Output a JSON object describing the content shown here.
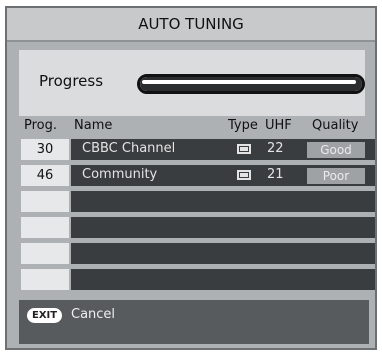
{
  "title": "AUTO TUNING",
  "progress": {
    "label": "Progress",
    "fraction": 1.0
  },
  "columns": {
    "prog": "Prog.",
    "name": "Name",
    "type": "Type",
    "uhf": "UHF",
    "quality": "Quality"
  },
  "channels": [
    {
      "prog": "30",
      "name": "CBBC Channel",
      "type_icon": "tv-icon",
      "uhf": "22",
      "quality": "Good"
    },
    {
      "prog": "46",
      "name": "Community",
      "type_icon": "tv-icon",
      "uhf": "21",
      "quality": "Poor"
    },
    {
      "prog": "",
      "name": "",
      "type_icon": "",
      "uhf": "",
      "quality": ""
    },
    {
      "prog": "",
      "name": "",
      "type_icon": "",
      "uhf": "",
      "quality": ""
    },
    {
      "prog": "",
      "name": "",
      "type_icon": "",
      "uhf": "",
      "quality": ""
    },
    {
      "prog": "",
      "name": "",
      "type_icon": "",
      "uhf": "",
      "quality": ""
    }
  ],
  "footer": {
    "exit_key": "EXIT",
    "cancel_label": "Cancel"
  }
}
